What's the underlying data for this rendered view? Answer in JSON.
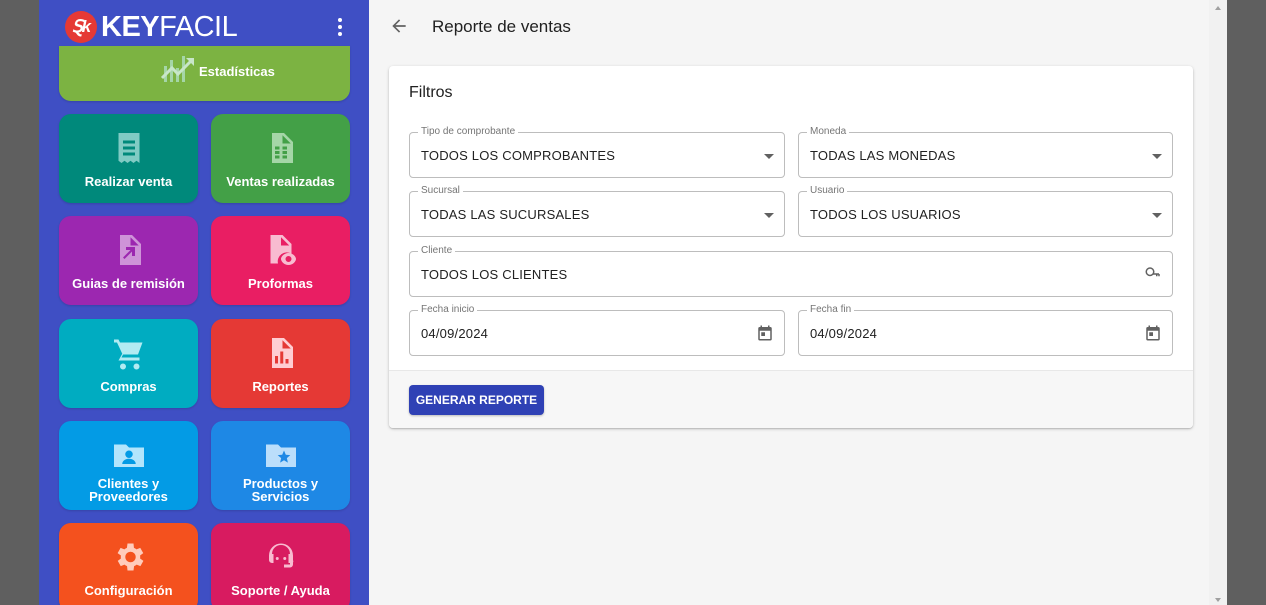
{
  "brand": {
    "badge": "Ȿk",
    "name_bold": "KEY",
    "name_light": "FACIL"
  },
  "sidebar": {
    "stats": {
      "label": "Estadísticas",
      "color": "#7cb342",
      "icon": "trending-up-icon"
    },
    "tiles": [
      {
        "label": "Realizar venta",
        "color": "#00897b",
        "icon": "receipt-icon"
      },
      {
        "label": "Ventas realizadas",
        "color": "#43a047",
        "icon": "spreadsheet-file-icon"
      },
      {
        "label": "Guias de remisión",
        "color": "#9c27b0",
        "icon": "file-export-icon"
      },
      {
        "label": "Proformas",
        "color": "#e91e63",
        "icon": "file-eye-icon"
      },
      {
        "label": "Compras",
        "color": "#00acc1",
        "icon": "cart-icon"
      },
      {
        "label": "Reportes",
        "color": "#e53935",
        "icon": "chart-file-icon"
      },
      {
        "label": "Clientes y Proveedores",
        "color": "#039be5",
        "icon": "folder-user-icon"
      },
      {
        "label": "Productos y Servicios",
        "color": "#1e88e5",
        "icon": "folder-star-icon"
      },
      {
        "label": "Configuración",
        "color": "#f4511e",
        "icon": "gear-icon"
      },
      {
        "label": "Soporte / Ayuda",
        "color": "#d81b60",
        "icon": "support-agent-icon"
      }
    ]
  },
  "topbar": {
    "title": "Reporte de ventas"
  },
  "filters": {
    "title": "Filtros",
    "tipo": {
      "label": "Tipo de comprobante",
      "value": "TODOS LOS COMPROBANTES"
    },
    "moneda": {
      "label": "Moneda",
      "value": "TODAS LAS MONEDAS"
    },
    "sucursal": {
      "label": "Sucursal",
      "value": "TODAS LAS SUCURSALES"
    },
    "usuario": {
      "label": "Usuario",
      "value": "TODOS LOS USUARIOS"
    },
    "cliente": {
      "label": "Cliente",
      "value": "TODOS LOS CLIENTES"
    },
    "fecha_inicio": {
      "label": "Fecha inicio",
      "value": "04/09/2024"
    },
    "fecha_fin": {
      "label": "Fecha fin",
      "value": "04/09/2024"
    },
    "generate_label": "GENERAR REPORTE"
  },
  "colors": {
    "sidebar": "#3f4fc4",
    "primary_button": "#2f41b5",
    "background": "#f5f5f5"
  }
}
